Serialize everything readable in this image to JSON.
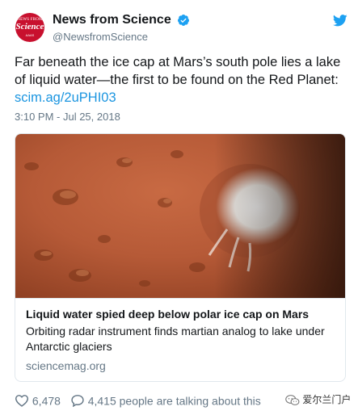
{
  "author": {
    "display_name": "News from Science",
    "handle": "@NewsfromScience",
    "avatar_top": "NEWS FROM",
    "avatar_main": "Science",
    "avatar_sub": "AAAS",
    "avatar_color": "#c8102e"
  },
  "tweet": {
    "text": "Far beneath the ice cap at Mars’s south pole lies a lake of liquid water—the first to be found on the Red Planet: ",
    "link": "scim.ag/2uPHI03",
    "timestamp": "3:10 PM - Jul 25, 2018"
  },
  "card": {
    "title": "Liquid water spied deep below polar ice cap on Mars",
    "description": "Orbiting radar instrument finds martian analog to lake under Antarctic glaciers",
    "domain": "sciencemag.org"
  },
  "actions": {
    "likes": "6,478",
    "talking": "4,415 people are talking about this"
  },
  "watermark": {
    "text": "爱尔兰门户"
  },
  "colors": {
    "link": "#1b95e0",
    "secondary": "#657786",
    "verified": "#1da1f2",
    "twitter_bird": "#1da1f2",
    "mars_surface": "#b65a37"
  }
}
